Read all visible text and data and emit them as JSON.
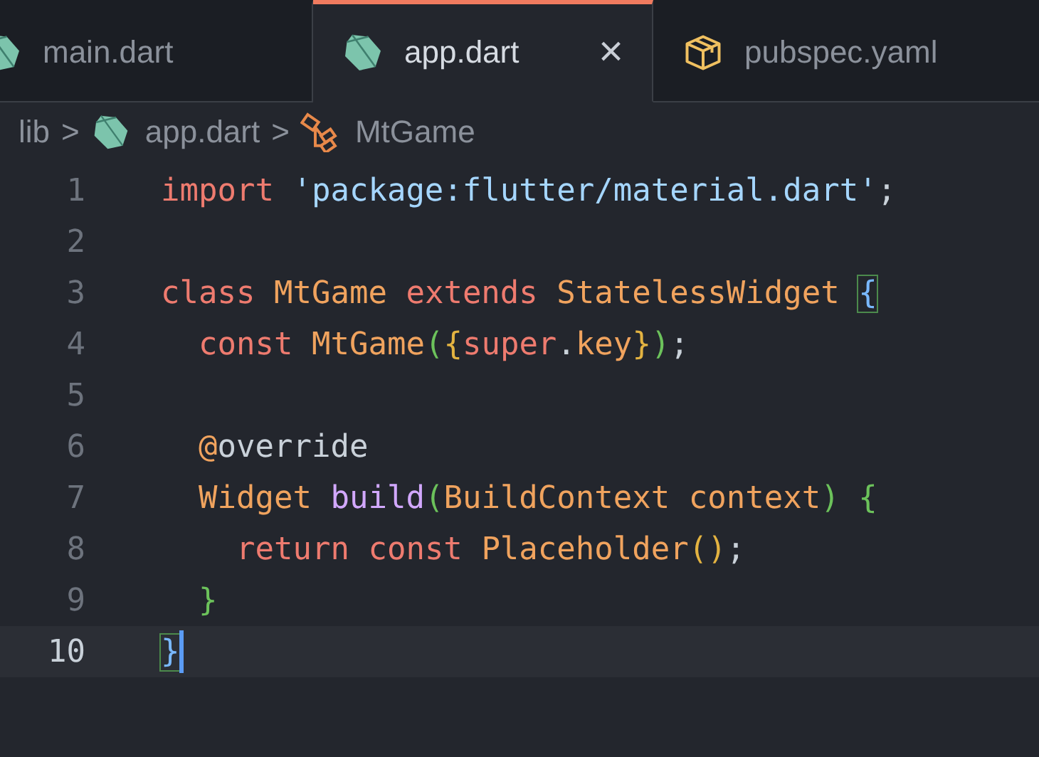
{
  "tabs": [
    {
      "label": "main.dart",
      "kind": "dart",
      "selected": false
    },
    {
      "label": "app.dart",
      "kind": "dart",
      "selected": true,
      "close": "×"
    },
    {
      "label": "pubspec.yaml",
      "kind": "package",
      "selected": false
    }
  ],
  "breadcrumb": [
    {
      "label": "lib",
      "kind": "folder"
    },
    {
      "label": "app.dart",
      "kind": "dart"
    },
    {
      "label": "MtGame",
      "kind": "class"
    }
  ],
  "breadcrumb_separator": ">",
  "lines": [
    {
      "number": "1",
      "current": false,
      "cursor": false,
      "tokens": [
        {
          "text": "import ",
          "color": "#ee7b6f"
        },
        {
          "text": "'package:flutter/material.dart'",
          "color": "#a5d6ff"
        },
        {
          "text": ";",
          "color": "#c9d1d9"
        }
      ]
    },
    {
      "number": "2",
      "current": false,
      "cursor": false
    },
    {
      "number": "3",
      "current": false,
      "cursor": false,
      "tokens": [
        {
          "text": "class ",
          "color": "#ee7b6f"
        },
        {
          "text": "MtGame ",
          "color": "#f0a35e"
        },
        {
          "text": "extends ",
          "color": "#ee7b6f"
        },
        {
          "text": "StatelessWidget ",
          "color": "#f0a35e"
        },
        {
          "text": "{",
          "color": "#79b8ff",
          "matched": true
        }
      ]
    },
    {
      "number": "4",
      "current": false,
      "cursor": false,
      "tokens": [
        {
          "text": "  const ",
          "color": "#ee7b6f"
        },
        {
          "text": "MtGame",
          "color": "#f0a35e"
        },
        {
          "text": "(",
          "color": "#6cc25b"
        },
        {
          "text": "{",
          "color": "#e3b341"
        },
        {
          "text": "super",
          "color": "#ee7b6f"
        },
        {
          "text": ".",
          "color": "#c9d1d9"
        },
        {
          "text": "key",
          "color": "#f0a35e"
        },
        {
          "text": "}",
          "color": "#e3b341"
        },
        {
          "text": ")",
          "color": "#6cc25b"
        },
        {
          "text": ";",
          "color": "#c9d1d9"
        }
      ]
    },
    {
      "number": "5",
      "current": false,
      "cursor": false
    },
    {
      "number": "6",
      "current": false,
      "cursor": false,
      "tokens": [
        {
          "text": "  @",
          "color": "#f0a35e"
        },
        {
          "text": "override",
          "color": "#c9d1d9"
        }
      ]
    },
    {
      "number": "7",
      "current": false,
      "cursor": false,
      "tokens": [
        {
          "text": "  Widget ",
          "color": "#f0a35e"
        },
        {
          "text": "build",
          "color": "#d2a8ff"
        },
        {
          "text": "(",
          "color": "#6cc25b"
        },
        {
          "text": "BuildContext ",
          "color": "#f0a35e"
        },
        {
          "text": "context",
          "color": "#f0a35e"
        },
        {
          "text": ") ",
          "color": "#6cc25b"
        },
        {
          "text": "{",
          "color": "#6cc25b"
        }
      ]
    },
    {
      "number": "8",
      "current": false,
      "cursor": false,
      "tokens": [
        {
          "text": "    return ",
          "color": "#ee7b6f"
        },
        {
          "text": "const ",
          "color": "#ee7b6f"
        },
        {
          "text": "Placeholder",
          "color": "#f0a35e"
        },
        {
          "text": "()",
          "color": "#e3b341"
        },
        {
          "text": ";",
          "color": "#c9d1d9"
        }
      ]
    },
    {
      "number": "9",
      "current": false,
      "cursor": false,
      "tokens": [
        {
          "text": "  }",
          "color": "#6cc25b"
        }
      ]
    },
    {
      "number": "10",
      "current": true,
      "cursor": true,
      "tokens": [
        {
          "text": "}",
          "color": "#79b8ff",
          "matched": true
        }
      ]
    }
  ]
}
